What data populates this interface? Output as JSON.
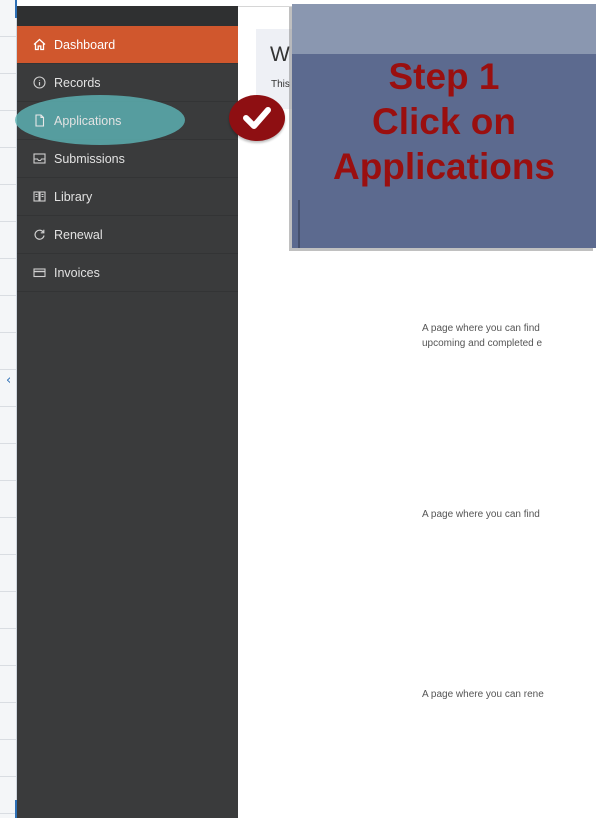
{
  "sidebar": {
    "items": [
      {
        "label": "Dashboard",
        "icon": "home-icon"
      },
      {
        "label": "Records",
        "icon": "info-icon"
      },
      {
        "label": "Applications",
        "icon": "document-icon"
      },
      {
        "label": "Submissions",
        "icon": "inbox-icon"
      },
      {
        "label": "Library",
        "icon": "book-icon"
      },
      {
        "label": "Renewal",
        "icon": "refresh-icon"
      },
      {
        "label": "Invoices",
        "icon": "card-icon"
      }
    ],
    "active_item": "Dashboard"
  },
  "welcome": {
    "title": "W",
    "subtitle": "This"
  },
  "descriptions": [
    {
      "line1": "A page where you can find",
      "line2": "upcoming and completed e"
    },
    {
      "line1": "A page where you can find"
    },
    {
      "line1": "A page where you can rene"
    }
  ],
  "callout": {
    "line1": "Step 1",
    "line2": "Click on",
    "line3": "Applications"
  },
  "colors": {
    "sidebar_bg": "#3a3b3c",
    "active_item": "#d0572d",
    "highlight": "#5db3b4",
    "callout_bg": "#5c6a8f",
    "callout_text": "#9a0f0f",
    "badge": "#8e0f12"
  }
}
